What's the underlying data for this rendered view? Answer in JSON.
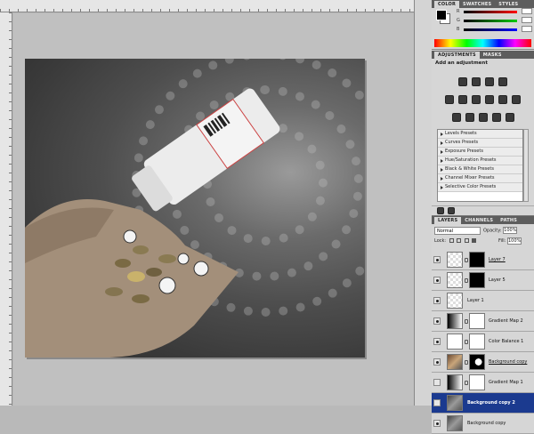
{
  "color_panel": {
    "tabs": [
      "COLOR",
      "SWATCHES",
      "STYLES"
    ],
    "channels": [
      {
        "label": "R",
        "value": "",
        "color": "#ff0000"
      },
      {
        "label": "G",
        "value": "",
        "color": "#00c000"
      },
      {
        "label": "B",
        "value": "",
        "color": "#0000ff"
      }
    ]
  },
  "adjustments": {
    "tabs": [
      "ADJUSTMENTS",
      "MASKS"
    ],
    "title": "Add an adjustment",
    "presets": [
      "Levels Presets",
      "Curves Presets",
      "Exposure Presets",
      "Hue/Saturation Presets",
      "Black & White Presets",
      "Channel Mixer Presets",
      "Selective Color Presets"
    ]
  },
  "layers_panel": {
    "tabs": [
      "LAYERS",
      "CHANNELS",
      "PATHS"
    ],
    "blend_mode": "Normal",
    "opacity_label": "Opacity:",
    "opacity_value": "100%",
    "lock_label": "Lock:",
    "fill_label": "Fill:",
    "fill_value": "100%",
    "layers": [
      {
        "name": "Layer 7",
        "visible": true,
        "thumb": "checker",
        "mask": "black",
        "selected": false,
        "underline": true
      },
      {
        "name": "Layer 5",
        "visible": true,
        "thumb": "checker",
        "mask": "black",
        "selected": false,
        "underline": false
      },
      {
        "name": "Layer 1",
        "visible": true,
        "thumb": "checker",
        "mask": "",
        "selected": false,
        "underline": false
      },
      {
        "name": "Gradient Map 2",
        "visible": true,
        "thumb": "grad",
        "mask": "white",
        "selected": false,
        "underline": false
      },
      {
        "name": "Color Balance 1",
        "visible": true,
        "thumb": "bal",
        "mask": "white",
        "selected": false,
        "underline": false
      },
      {
        "name": "Background copy",
        "visible": true,
        "thumb": "photo",
        "mask": "shape",
        "selected": false,
        "underline": true
      },
      {
        "name": "Gradient Map 1",
        "visible": false,
        "thumb": "grad",
        "mask": "white",
        "selected": false,
        "underline": false
      },
      {
        "name": "Background copy 2",
        "visible": false,
        "thumb": "gray",
        "mask": "",
        "selected": true,
        "underline": false
      },
      {
        "name": "Background copy",
        "visible": true,
        "thumb": "gray",
        "mask": "",
        "selected": false,
        "underline": false
      }
    ]
  }
}
